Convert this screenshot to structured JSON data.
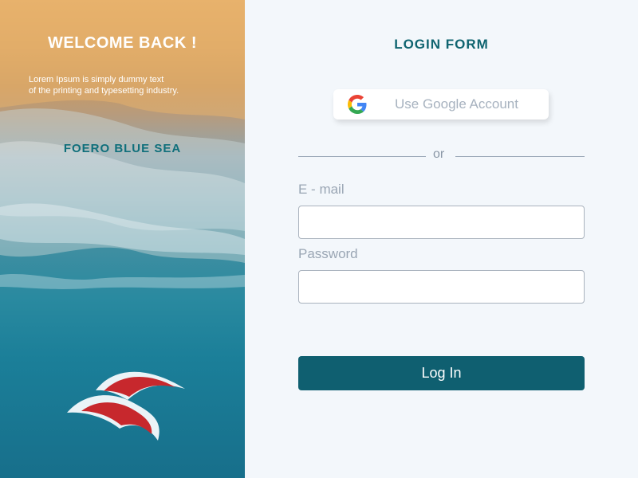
{
  "left_panel": {
    "heading": "WELCOME BACK !",
    "subtext_line1": "Lorem Ipsum is simply dummy text",
    "subtext_line2": "of the printing and typesetting industry.",
    "brand_name": "FOERO BLUE SEA",
    "logo": "wave-logo"
  },
  "form": {
    "title": "LOGIN FORM",
    "google_button_label": "Use Google Account",
    "google_icon": "google-icon",
    "divider_text": "or",
    "email_label": "E - mail",
    "email_value": "",
    "password_label": "Password",
    "password_value": "",
    "login_button_label": "Log In"
  },
  "colors": {
    "accent": "#0f5f70",
    "title": "#0f6470",
    "background": "#f3f7fb",
    "logo_red": "#c7282d"
  }
}
